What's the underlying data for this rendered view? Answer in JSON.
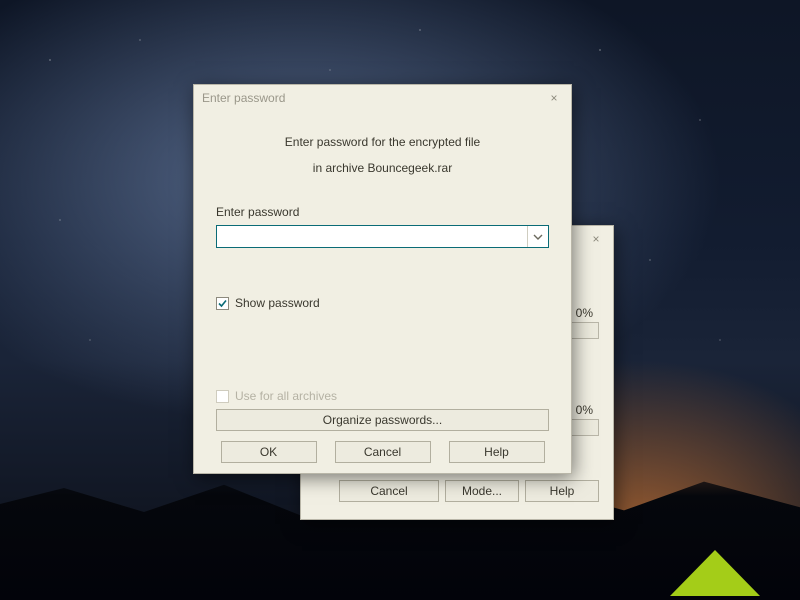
{
  "progress_window": {
    "close_icon": "×",
    "percent1": "0%",
    "percent2": "0%",
    "buttons": {
      "cancel": "Cancel",
      "mode": "Mode...",
      "help": "Help"
    }
  },
  "password_window": {
    "title": "Enter password",
    "close_icon": "×",
    "line1": "Enter password for the encrypted file",
    "line2": "in archive Bouncegeek.rar",
    "field_label": "Enter password",
    "field_value": "",
    "show_password": {
      "label": "Show password",
      "checked": true
    },
    "use_all": {
      "label": "Use for all archives",
      "checked": false,
      "enabled": false
    },
    "organize": "Organize passwords...",
    "buttons": {
      "ok": "OK",
      "cancel": "Cancel",
      "help": "Help"
    }
  }
}
